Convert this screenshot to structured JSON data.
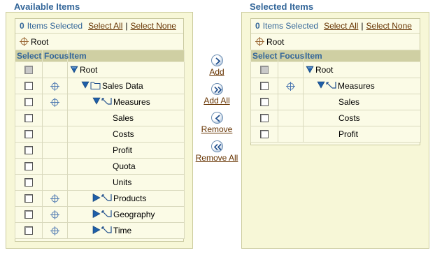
{
  "available": {
    "title": "Available Items",
    "count": "0",
    "selected_label": "Items Selected",
    "select_all": "Select All",
    "select_none": "Select None",
    "focus_root": "Root",
    "columns": {
      "select": "Select",
      "focus": "Focus",
      "item": "Item"
    },
    "rows": [
      {
        "label": "Root",
        "icon": "expanded-triangle-icon",
        "checkbox_disabled": true,
        "focus_icon": false
      },
      {
        "label": "Sales Data",
        "icon": "folder-icon",
        "checkbox_disabled": false,
        "focus_icon": true
      },
      {
        "label": "Measures",
        "icon": "dimension-icon",
        "checkbox_disabled": false,
        "focus_icon": true
      },
      {
        "label": "Sales",
        "icon": "",
        "checkbox_disabled": false,
        "focus_icon": false
      },
      {
        "label": "Costs",
        "icon": "",
        "checkbox_disabled": false,
        "focus_icon": false
      },
      {
        "label": "Profit",
        "icon": "",
        "checkbox_disabled": false,
        "focus_icon": false
      },
      {
        "label": "Quota",
        "icon": "",
        "checkbox_disabled": false,
        "focus_icon": false
      },
      {
        "label": "Units",
        "icon": "",
        "checkbox_disabled": false,
        "focus_icon": false
      },
      {
        "label": "Products",
        "icon": "collapsed-dimension-icon",
        "checkbox_disabled": false,
        "focus_icon": true
      },
      {
        "label": "Geography",
        "icon": "collapsed-dimension-icon",
        "checkbox_disabled": false,
        "focus_icon": true
      },
      {
        "label": "Time",
        "icon": "collapsed-dimension-icon",
        "checkbox_disabled": false,
        "focus_icon": true
      }
    ]
  },
  "buttons": {
    "add": "Add",
    "add_all": "Add All",
    "remove": "Remove",
    "remove_all": "Remove All"
  },
  "selected": {
    "title": "Selected Items",
    "count": "0",
    "selected_label": "Items Selected",
    "select_all": "Select All",
    "select_none": "Select None",
    "focus_root": "Root",
    "columns": {
      "select": "Select",
      "focus": "Focus",
      "item": "Item"
    },
    "rows": [
      {
        "label": "Root",
        "icon": "expanded-triangle-icon",
        "checkbox_disabled": true,
        "focus_icon": false
      },
      {
        "label": "Measures",
        "icon": "dimension-icon",
        "checkbox_disabled": false,
        "focus_icon": true
      },
      {
        "label": "Sales",
        "icon": "",
        "checkbox_disabled": false,
        "focus_icon": false
      },
      {
        "label": "Costs",
        "icon": "",
        "checkbox_disabled": false,
        "focus_icon": false
      },
      {
        "label": "Profit",
        "icon": "",
        "checkbox_disabled": false,
        "focus_icon": false
      }
    ]
  },
  "colors": {
    "accent": "#336699",
    "link": "#663300",
    "panel_bg": "#f7f7d7",
    "header_bg": "#cfcfa3"
  }
}
